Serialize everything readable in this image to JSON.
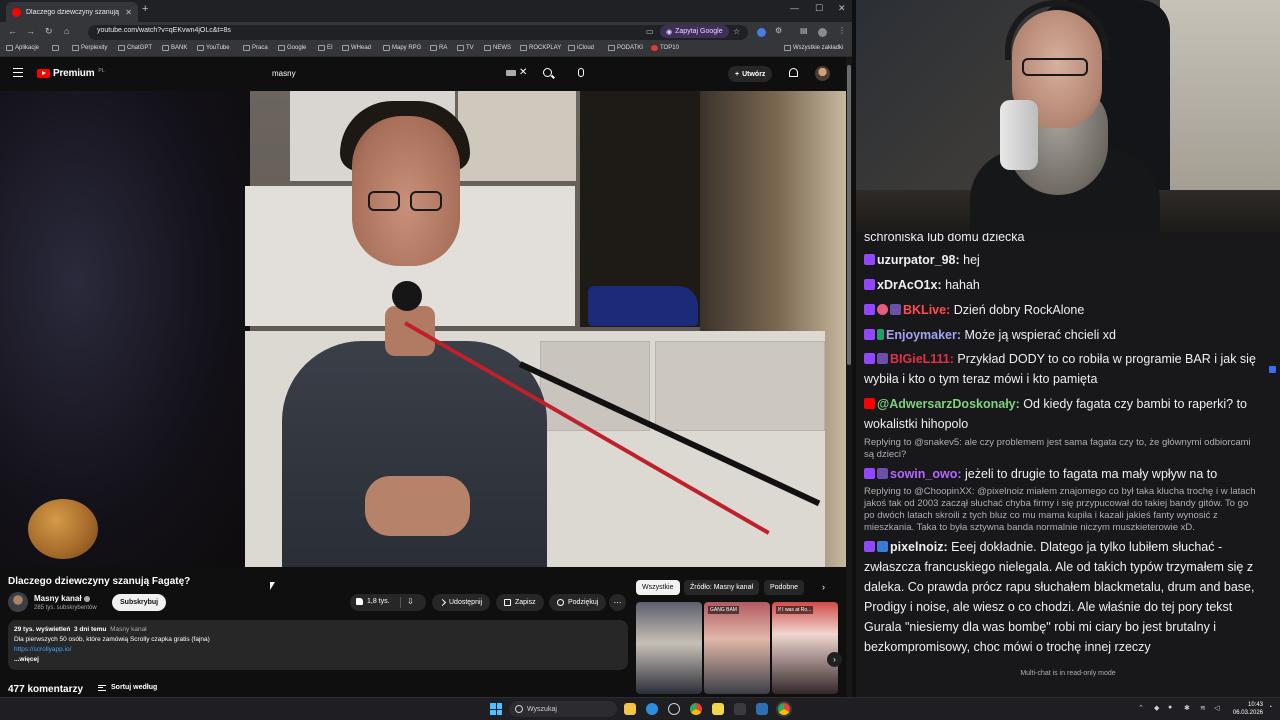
{
  "browser": {
    "tab_title": "Dlaczego dziewczyny szanują F",
    "url": "youtube.com/watch?v=qEKvwn4jOLc&t=8s",
    "ask_google": "Zapytaj Google",
    "bookmarks": [
      "Aplikacje",
      "Perplexity",
      "ChatGPT",
      "BANK",
      "YouTube",
      "Praca",
      "Google",
      "EI",
      "WHead",
      "Mapy RPG",
      "RA",
      "TV",
      "NEWS",
      "ROCKPLAY",
      "iCloud",
      "PODATKI",
      "TOP10"
    ],
    "all_bookmarks": "Wszystkie zakładki"
  },
  "youtube": {
    "logo_text": "Premium",
    "logo_region": "PL",
    "search_query": "masny",
    "create_label": "Utwórz",
    "video_title": "Dlaczego dziewczyny szanują Fagatę?",
    "channel_name": "Masny kanał",
    "channel_subs": "285 tys. subskrybentów",
    "subscribe_label": "Subskrybuj",
    "likes": "1,8 tys.",
    "share_label": "Udostępnij",
    "save_label": "Zapisz",
    "thanks_label": "Podziękuj",
    "chips": [
      "Wszystkie",
      "Źródło: Masny kanał",
      "Podobne"
    ],
    "thumb_labels": [
      "",
      "GANG BAM",
      "If I was at Ro..."
    ],
    "desc_views": "29 tys. wyświetleń",
    "desc_age": "3 dni temu",
    "desc_tag": "Masny kanał",
    "desc_line": "Dla pierwszych 50 osób, które zamówią Scrolly czapka gratis (fajna)",
    "desc_link": "https://scrollyapp.io/",
    "desc_more": "...więcej",
    "comments_count": "477 komentarzy",
    "sort_label": "Sortuj według"
  },
  "chat": {
    "top_partial": "schroniska lub domu dziecka",
    "messages": [
      {
        "user": "uzurpator_98:",
        "text": "hej",
        "color": "#efeff1"
      },
      {
        "user": "xDrAcO1x:",
        "text": "hahah",
        "color": "#efeff1"
      },
      {
        "user": "BKLive:",
        "text": "Dzień dobry RockAlone",
        "color": "#ff4d4d"
      },
      {
        "user": "Enjoymaker:",
        "text": "Może ją wspierać chcieli xd",
        "color": "#a3a3f5"
      },
      {
        "user": "BIGieL111:",
        "text": "Przykład DODY to co robiła w programie BAR i jak się wybiła i kto o tym teraz mówi i kto pamięta",
        "color": "#e0314a"
      },
      {
        "user": "@AdwersarzDoskonały:",
        "text": "Od kiedy fagata czy bambi to raperki? to wokalistki hihopolo",
        "color": "#7fd17f"
      },
      {
        "reply": "Replying to @snakev5: ale czy problemem jest sama fagata czy to, że głównymi odbiorcami są dzieci?"
      },
      {
        "user": "sowin_owo:",
        "text": "jeżeli to drugie to fagata ma mały wpływ na to",
        "color": "#b567ff"
      },
      {
        "reply": "Replying to @ChoopinXX: @pixelnoiz miałem znajomego co był taka klucha trochę i w latach jakoś tak od 2003 zaczął słuchać chyba firmy i się przypucował do takiej bandy gitów. To go po dwóch latach skroili z tych bluz co mu mama kupiła i kazali jakieś fanty wynosić z mieszkania. Taka to była sztywna banda normalnie niczym muszkieterowie xD."
      },
      {
        "user": "pixelnoiz:",
        "text": "Eeej dokładnie. Dlatego ja tylko lubiłem słuchać - zwłaszcza francuskiego nielegala. Ale od takich typów trzymałem się z daleka. Co prawda prócz rapu słuchałem blackmetalu, drum and base, Prodigy i noise, ale wiesz o co chodzi. Ale właśnie do tej pory tekst Gurala \"niesiemy dla was bombę\" robi mi ciary bo jest brutalny i bezkompromisowy, choc mówi o trochę innej rzeczy",
        "color": "#efeff1"
      }
    ],
    "readonly_note": "Multi-chat is in read-only mode"
  },
  "taskbar": {
    "search_label": "Wyszukaj",
    "time": "10:43",
    "date": "06.03.2026"
  }
}
